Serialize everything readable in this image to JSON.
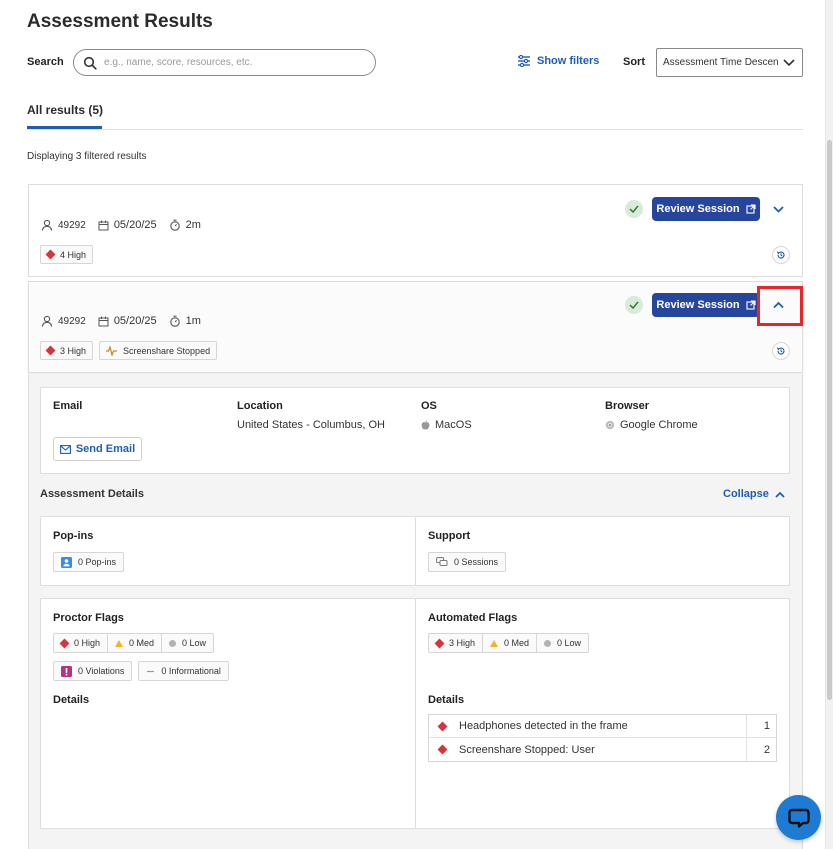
{
  "page": {
    "title": "Assessment Results"
  },
  "toolbar": {
    "search_label": "Search",
    "search_placeholder": "e.g., name, score, resources, etc.",
    "show_filters": "Show filters",
    "sort_label": "Sort",
    "sort_value": "Assessment Time Descending"
  },
  "tabs": {
    "all_results": "All results (5)"
  },
  "results": {
    "displaying": "Displaying 3 filtered results"
  },
  "sessions": [
    {
      "user_id": "49292",
      "date": "05/20/25",
      "duration": "2m",
      "chips": [
        {
          "label": "4 High"
        }
      ],
      "review_label": "Review Session"
    },
    {
      "user_id": "49292",
      "date": "05/20/25",
      "duration": "1m",
      "chips": [
        {
          "label": "3 High"
        },
        {
          "label": "Screenshare Stopped"
        }
      ],
      "review_label": "Review Session"
    }
  ],
  "details": {
    "email_label": "Email",
    "send_email": "Send Email",
    "location_label": "Location",
    "location_value": "United States - Columbus, OH",
    "os_label": "OS",
    "os_value": "MacOS",
    "browser_label": "Browser",
    "browser_value": "Google Chrome",
    "assessment_details": "Assessment Details",
    "collapse": "Collapse",
    "popins_title": "Pop-ins",
    "popins_value": "0 Pop-ins",
    "support_title": "Support",
    "support_value": "0 Sessions",
    "proctor_title": "Proctor Flags",
    "proctor_high": "0 High",
    "proctor_med": "0 Med",
    "proctor_low": "0 Low",
    "proctor_violations": "0 Violations",
    "proctor_informational": "0 Informational",
    "proctor_details": "Details",
    "auto_title": "Automated Flags",
    "auto_high": "3 High",
    "auto_med": "0 Med",
    "auto_low": "0 Low",
    "auto_details": "Details",
    "auto_flags": [
      {
        "name": "Headphones detected in the frame",
        "count": "1"
      },
      {
        "name": "Screenshare Stopped: User",
        "count": "2"
      }
    ]
  },
  "colors": {
    "primary": "#26469e",
    "link": "#1f5db5",
    "high": "#d8343c",
    "med": "#f0b429",
    "low": "#b3b3b3",
    "highlight": "#e5262a",
    "chat": "#1e7bd4"
  },
  "icons": [
    "search-icon",
    "filter-icon",
    "chevron-down-icon",
    "user-icon",
    "calendar-icon",
    "timer-icon",
    "check-icon",
    "external-link-icon",
    "history-icon",
    "chevron-up-icon",
    "mail-icon",
    "apple-icon",
    "chrome-icon",
    "person-badge-icon",
    "chat-bubbles-icon",
    "exclamation-icon",
    "minus-icon",
    "chat-icon"
  ]
}
